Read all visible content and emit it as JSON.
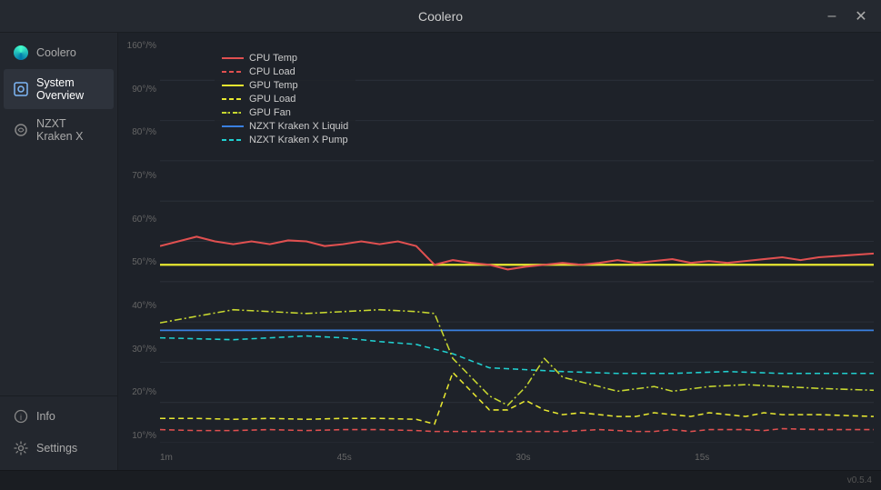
{
  "titlebar": {
    "title": "Coolero",
    "minimize_label": "–",
    "close_label": "✕"
  },
  "sidebar": {
    "app_name": "Coolero",
    "items": [
      {
        "id": "system-overview",
        "label": "System Overview",
        "active": true
      },
      {
        "id": "nzxt-kraken-x",
        "label": "NZXT Kraken X",
        "active": false
      }
    ],
    "bottom_items": [
      {
        "id": "info",
        "label": "Info"
      },
      {
        "id": "settings",
        "label": "Settings"
      }
    ]
  },
  "chart": {
    "y_labels": [
      "160°/%",
      "90°/%",
      "80°/%",
      "70°/%",
      "60°/%",
      "50°/%",
      "40°/%",
      "30°/%",
      "20°/%",
      "10°/%"
    ],
    "x_labels": [
      "1m",
      "45s",
      "30s",
      "15s",
      ""
    ],
    "legend": [
      {
        "id": "cpu-temp",
        "label": "CPU Temp",
        "color": "#e05050",
        "style": "solid"
      },
      {
        "id": "cpu-load",
        "label": "CPU Load",
        "color": "#e05050",
        "style": "dashed"
      },
      {
        "id": "gpu-temp",
        "label": "GPU Temp",
        "color": "#e8e830",
        "style": "solid"
      },
      {
        "id": "gpu-load",
        "label": "GPU Load",
        "color": "#e8e830",
        "style": "dashed"
      },
      {
        "id": "gpu-fan",
        "label": "GPU Fan",
        "color": "#c8e830",
        "style": "dash-dot"
      },
      {
        "id": "kraken-liquid",
        "label": "NZXT Kraken X Liquid",
        "color": "#3a80e0",
        "style": "solid"
      },
      {
        "id": "kraken-pump",
        "label": "NZXT Kraken X Pump",
        "color": "#20d0d0",
        "style": "dashed"
      }
    ]
  },
  "statusbar": {
    "version": "v0.5.4"
  }
}
